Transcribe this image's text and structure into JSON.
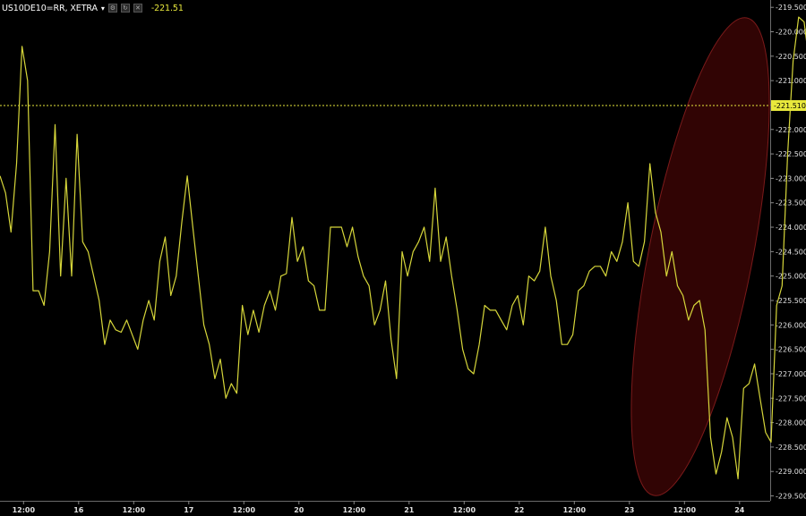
{
  "header": {
    "symbol": "US10DE10=RR, XETRA",
    "caret": "▾",
    "icons": [
      "settings-icon",
      "refresh-icon",
      "close-icon"
    ],
    "last_price": "-221.51"
  },
  "colors": {
    "background": "#000000",
    "line": "#d6d63a",
    "last_price_line": "#e8e83c",
    "highlight_fill": "#3a0505",
    "highlight_stroke": "#7a1a1a",
    "axis_text": "#e0e0e0"
  },
  "chart_data": {
    "type": "line",
    "title": "",
    "xlabel": "",
    "ylabel": "",
    "ylim": [
      -229.6,
      -219.35
    ],
    "y_ticks": [
      "-219.500",
      "-220.000",
      "-220.500",
      "-221.000",
      "-221.500",
      "-222.000",
      "-222.500",
      "-223.000",
      "-223.500",
      "-224.000",
      "-224.500",
      "-225.000",
      "-225.500",
      "-226.000",
      "-226.500",
      "-227.000",
      "-227.500",
      "-228.000",
      "-228.500",
      "-229.000",
      "-229.500"
    ],
    "x_ticks": [
      {
        "label": "12:00",
        "i": 2
      },
      {
        "label": "16",
        "i": 12
      },
      {
        "label": "12:00",
        "i": 22
      },
      {
        "label": "17",
        "i": 32
      },
      {
        "label": "12:00",
        "i": 42
      },
      {
        "label": "20",
        "i": 52
      },
      {
        "label": "12:00",
        "i": 62
      },
      {
        "label": "21",
        "i": 72
      },
      {
        "label": "12:00",
        "i": 82
      },
      {
        "label": "22",
        "i": 92
      },
      {
        "label": "12:00",
        "i": 102
      },
      {
        "label": "23",
        "i": 112
      },
      {
        "label": "12:00",
        "i": 122
      },
      {
        "label": "24",
        "i": 132
      }
    ],
    "last_price_label": "-221.510",
    "last_price_value": -221.51,
    "series": [
      {
        "values": [
          -222.95,
          -223.3,
          -224.1,
          -222.7,
          -220.3,
          -221.0,
          -225.3,
          -225.3,
          -225.6,
          -224.5,
          -221.9,
          -225.0,
          -223.0,
          -225.0,
          -222.1,
          -224.3,
          -224.5,
          -225.0,
          -225.5,
          -226.4,
          -225.9,
          -226.1,
          -226.15,
          -225.9,
          -226.2,
          -226.5,
          -225.9,
          -225.5,
          -225.9,
          -224.7,
          -224.2,
          -225.4,
          -225.0,
          -223.9,
          -222.95,
          -224.0,
          -225.0,
          -226.0,
          -226.4,
          -227.1,
          -226.7,
          -227.5,
          -227.2,
          -227.4,
          -225.6,
          -226.2,
          -225.7,
          -226.15,
          -225.6,
          -225.3,
          -225.7,
          -225.0,
          -224.95,
          -223.8,
          -224.7,
          -224.4,
          -225.1,
          -225.2,
          -225.7,
          -225.7,
          -224.0,
          -224.0,
          -224.0,
          -224.4,
          -224.0,
          -224.6,
          -225.0,
          -225.2,
          -226.0,
          -225.7,
          -225.1,
          -226.3,
          -227.1,
          -224.5,
          -225.0,
          -224.5,
          -224.3,
          -224.0,
          -224.7,
          -223.2,
          -224.7,
          -224.2,
          -225.0,
          -225.7,
          -226.5,
          -226.9,
          -227.0,
          -226.4,
          -225.6,
          -225.7,
          -225.7,
          -225.9,
          -226.1,
          -225.6,
          -225.4,
          -226.0,
          -225.0,
          -225.1,
          -224.9,
          -224.0,
          -225.0,
          -225.5,
          -226.4,
          -226.4,
          -226.2,
          -225.3,
          -225.2,
          -224.9,
          -224.8,
          -224.8,
          -225.0,
          -224.5,
          -224.7,
          -224.3,
          -223.5,
          -224.7,
          -224.8,
          -224.3,
          -222.7,
          -223.7,
          -224.1,
          -225.0,
          -224.5,
          -225.2,
          -225.4,
          -225.9,
          -225.6,
          -225.5,
          -226.1,
          -228.3,
          -229.05,
          -228.6,
          -227.9,
          -228.3,
          -229.15,
          -227.3,
          -227.2,
          -226.8,
          -227.5,
          -228.2,
          -228.4,
          -225.6,
          -225.2,
          -222.5,
          -220.6,
          -219.7,
          -219.8,
          -220.7,
          -220.25,
          -221.85,
          -221.5
        ]
      }
    ]
  }
}
